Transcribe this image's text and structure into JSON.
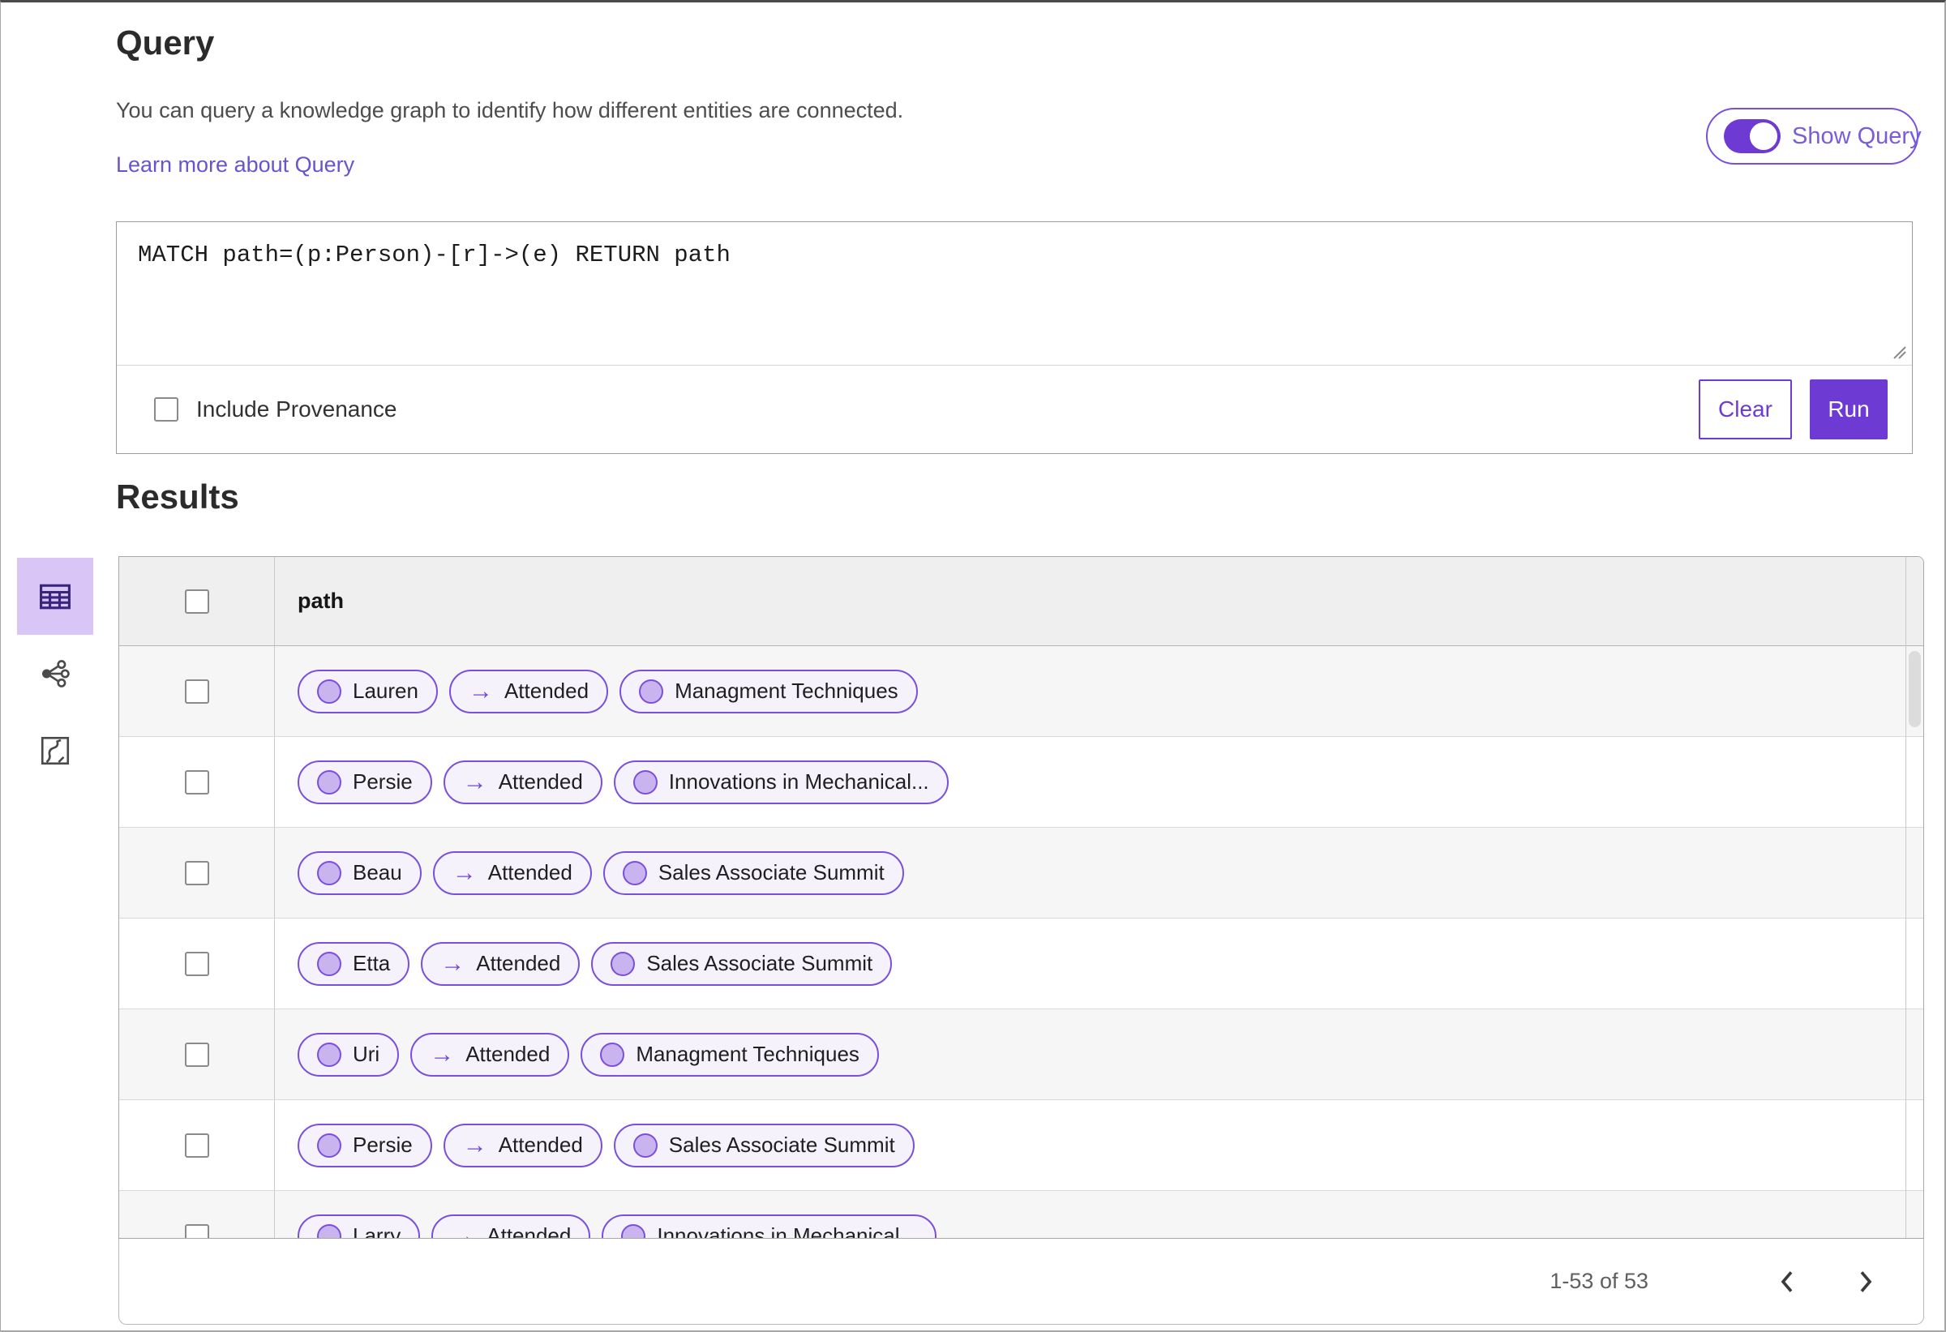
{
  "query_section": {
    "title": "Query",
    "description": "You can query a knowledge graph to identify how different entities are connected.",
    "learn_more_link": "Learn more about Query",
    "show_query_label": "Show Query",
    "show_query_on": true,
    "query_text": "MATCH path=(p:Person)-[r]->(e) RETURN path",
    "include_provenance_label": "Include Provenance",
    "include_provenance_checked": false,
    "clear_label": "Clear",
    "run_label": "Run"
  },
  "results_section": {
    "title": "Results",
    "column_header": "path",
    "views": [
      {
        "name": "table-view",
        "selected": true
      },
      {
        "name": "graph-view",
        "selected": false
      },
      {
        "name": "chart-view",
        "selected": false
      }
    ],
    "rows": [
      {
        "source": "Lauren",
        "edge": "Attended",
        "target": "Managment Techniques"
      },
      {
        "source": "Persie",
        "edge": "Attended",
        "target": "Innovations in Mechanical..."
      },
      {
        "source": "Beau",
        "edge": "Attended",
        "target": "Sales Associate Summit"
      },
      {
        "source": "Etta",
        "edge": "Attended",
        "target": "Sales Associate Summit"
      },
      {
        "source": "Uri",
        "edge": "Attended",
        "target": "Managment Techniques"
      },
      {
        "source": "Persie",
        "edge": "Attended",
        "target": "Sales Associate Summit"
      },
      {
        "source": "Larry",
        "edge": "Attended",
        "target": "Innovations in Mechanical..."
      }
    ],
    "pagination": {
      "range_label": "1-53 of 53"
    }
  },
  "icons": {
    "arrow_right": "→"
  },
  "colors": {
    "accent_purple": "#6d3bd4",
    "chip_border": "#7a4fdc",
    "chip_bg": "#f5f2fc",
    "node_dot_fill": "#c9b4ef",
    "selected_view_bg": "#d9c5f6",
    "link": "#6a53cf",
    "header_bg": "#efefef",
    "row_alt_bg": "#f6f6f6"
  }
}
